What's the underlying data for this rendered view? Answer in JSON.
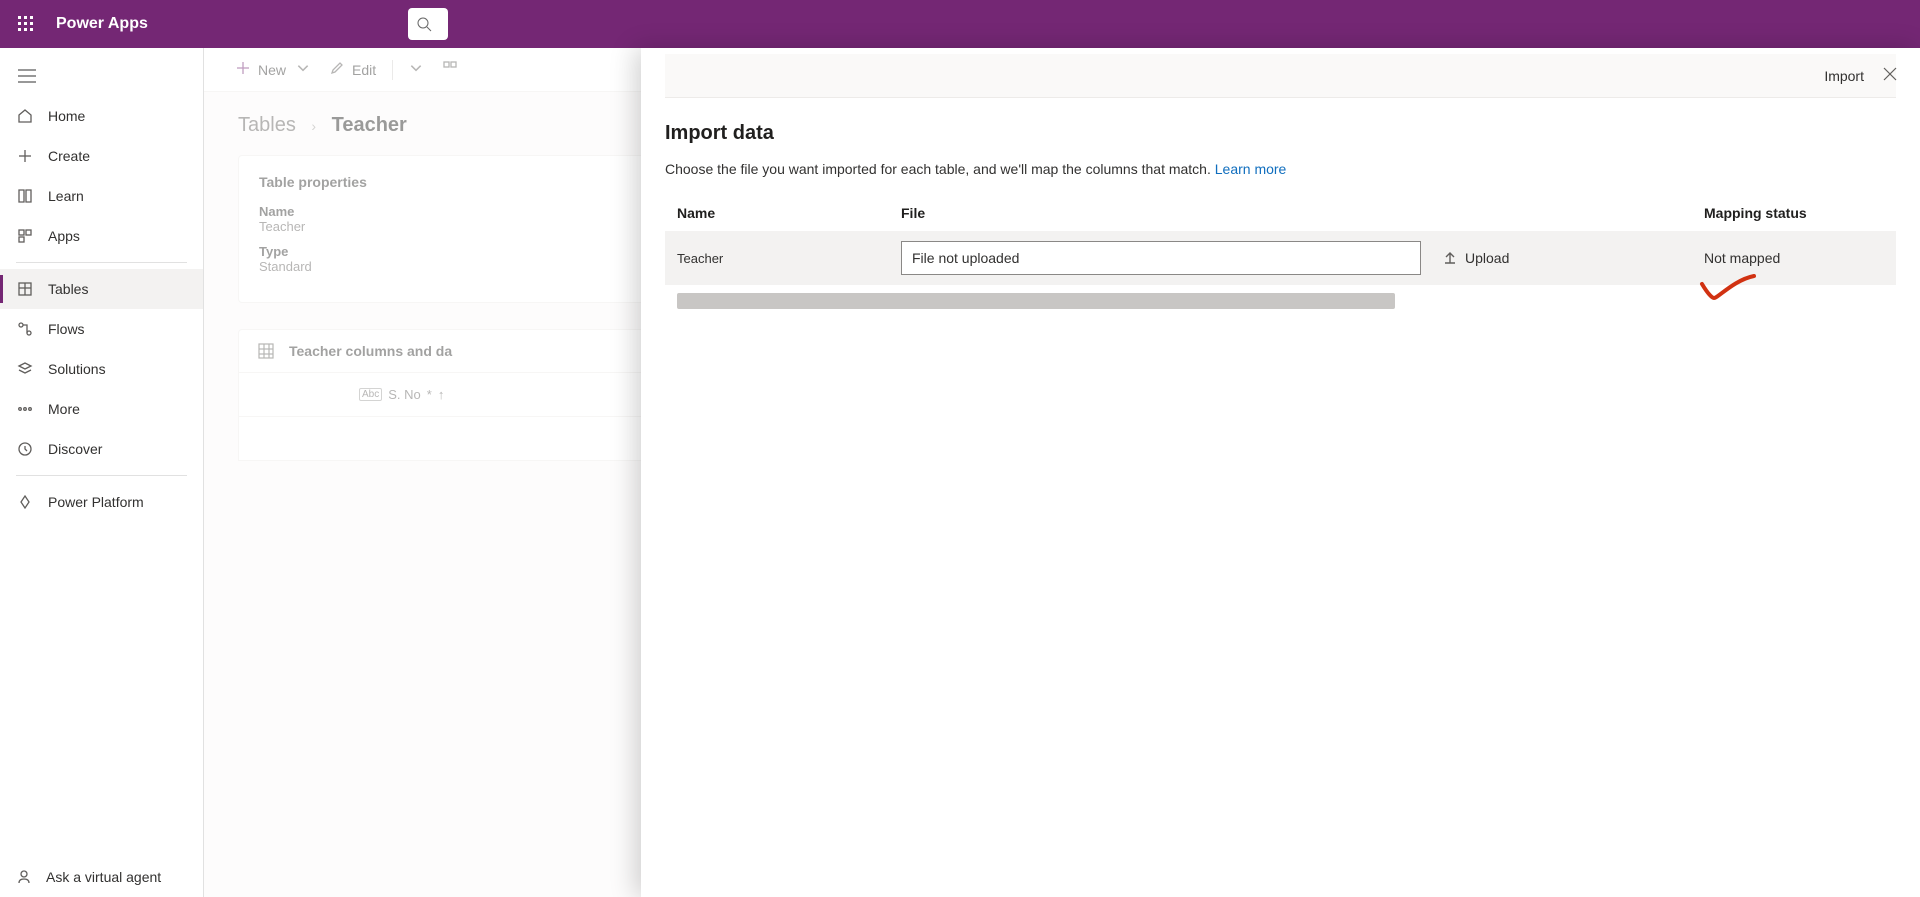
{
  "topbar": {
    "title": "Power Apps"
  },
  "nav": {
    "items": [
      {
        "label": "Home"
      },
      {
        "label": "Create"
      },
      {
        "label": "Learn"
      },
      {
        "label": "Apps"
      },
      {
        "label": "Tables"
      },
      {
        "label": "Flows"
      },
      {
        "label": "Solutions"
      },
      {
        "label": "More"
      },
      {
        "label": "Discover"
      },
      {
        "label": "Power Platform"
      }
    ],
    "ask": "Ask a virtual agent"
  },
  "cmd": {
    "new": "New",
    "edit": "Edit"
  },
  "breadcrumb": {
    "root": "Tables",
    "current": "Teacher"
  },
  "props": {
    "title": "Table properties",
    "name_label": "Name",
    "name_value": "Teacher",
    "type_label": "Type",
    "type_value": "Standard"
  },
  "grid": {
    "title": "Teacher columns and da",
    "col1": "S. No",
    "col1_suffix": "*"
  },
  "panel": {
    "import_btn": "Import",
    "title": "Import data",
    "desc": "Choose the file you want imported for each table, and we'll map the columns that match. ",
    "learn": "Learn more",
    "headers": {
      "name": "Name",
      "file": "File",
      "status": "Mapping status"
    },
    "row": {
      "name": "Teacher",
      "file_placeholder": "File not uploaded",
      "upload": "Upload",
      "status": "Not mapped"
    }
  }
}
